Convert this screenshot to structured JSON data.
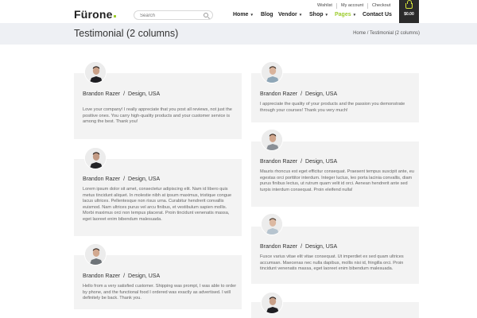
{
  "brand": {
    "logo": "Fürone",
    "accent": "#9ccc2c"
  },
  "search": {
    "placeholder": "Search"
  },
  "topbar": {
    "wishlist": "Wishlist",
    "account": "My account",
    "checkout": "Checkout"
  },
  "nav": {
    "items": [
      {
        "label": "Home",
        "caret": "▾"
      },
      {
        "label": "Blog",
        "caret": ""
      },
      {
        "label": "Vendor",
        "caret": "▾"
      },
      {
        "label": "Shop",
        "caret": "▾"
      },
      {
        "label": "Pages",
        "caret": "▾",
        "active": true
      },
      {
        "label": "Contact Us",
        "caret": ""
      }
    ]
  },
  "cart": {
    "total": "$0.00"
  },
  "page": {
    "title": "Testimonial (2 columns)",
    "breadcrumb": "Home / Testimonial (2 columns)"
  },
  "testimonials": {
    "left": [
      {
        "name": "Brandon Razer",
        "role": "Design, USA",
        "text": "Love your company! I really appreciate that you post all reviews, not just the positive ones. You carry high-quality products and your customer service is among the best. Thank you!"
      },
      {
        "name": "Brandon Razer",
        "role": "Design, USA",
        "text": "Lorem ipsum dolor sit amet, consectetur adipiscing elit. Nam id libero quis metus tincidunt aliquet. In molestie nibh at ipsum maximus, tristique congue lacus ultrices. Pellentesque non risus urna. Curabitur hendrerit convallis euismod. Nam ultrices purus vel arcu finibus, et vestibulum sapien mollis. Morbi maximus orci non tempus placerat. Proin tincidunt venenatis massa, eget laoreet enim bibendum malesuada."
      },
      {
        "name": "Brandon Razer",
        "role": "Design, USA",
        "text": "Hello from a very satisfied customer. Shipping was prompt, I was able to order by phone, and the functional food I ordered was exactly as advertised. I will definitely be back. Thank you."
      }
    ],
    "right": [
      {
        "name": "Brandon Razer",
        "role": "Design, USA",
        "text": "I appreciate the quality of your products and the passion you demonstrate through your courses! Thank you very much!"
      },
      {
        "name": "Brandon Razer",
        "role": "Design, USA",
        "text": "Mauris rhoncus est eget efficitur consequat. Praesent tempus suscipit ante, eu egestas orci porttitor interdum. Integer luctus, leo porta lacinia convallis, diam purus finibus lectus, ut rutrum quam velit id orci. Aenean hendrerit ante sed turpis interdum consequat. Proin eleifend nulla!"
      },
      {
        "name": "Brandon Razer",
        "role": "Design, USA",
        "text": "Fusce varius vitae elit vitae consequat. Ut imperdiet ex sed quam ultrices accumsan. Maecenas nec nulla dapibus, mollis nisi id, fringilla orci. Proin tincidunt venenatis massa, eget laoreet enim bibendum malesuada."
      }
    ]
  }
}
